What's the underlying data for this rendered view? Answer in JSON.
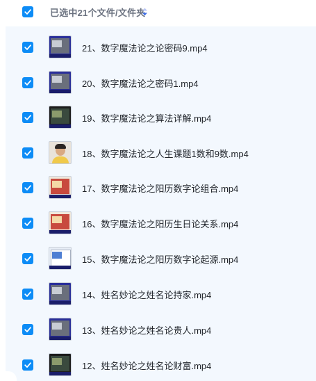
{
  "header": {
    "selection_text": "已选中21个文件/文件夹",
    "checked": true,
    "sort_icon": "sort-toggle-icon"
  },
  "files": [
    {
      "name": "21、数字魔法论之论密码9.mp4",
      "checked": true,
      "thumb": "video"
    },
    {
      "name": "20、数字魔法论之密码1.mp4",
      "checked": true,
      "thumb": "video"
    },
    {
      "name": "19、数字魔法论之算法详解.mp4",
      "checked": true,
      "thumb": "dark"
    },
    {
      "name": "18、数字魔法论之人生课题1数和9数.mp4",
      "checked": true,
      "thumb": "face"
    },
    {
      "name": "17、数字魔法论之阳历数字论组合.mp4",
      "checked": true,
      "thumb": "red"
    },
    {
      "name": "16、数字魔法论之阳历生日论关系.mp4",
      "checked": true,
      "thumb": "red"
    },
    {
      "name": "15、数字魔法论之阳历数字论起源.mp4",
      "checked": true,
      "thumb": "light"
    },
    {
      "name": "14、姓名妙论之姓名论持家.mp4",
      "checked": true,
      "thumb": "video"
    },
    {
      "name": "13、姓名妙论之姓名论贵人.mp4",
      "checked": true,
      "thumb": "video"
    },
    {
      "name": "12、姓名妙论之姓名论财富.mp4",
      "checked": true,
      "thumb": "dark"
    }
  ],
  "colors": {
    "checkbox": "#0d8cf6",
    "list_background": "#f3f8fe",
    "header_text": "#6b7280"
  }
}
